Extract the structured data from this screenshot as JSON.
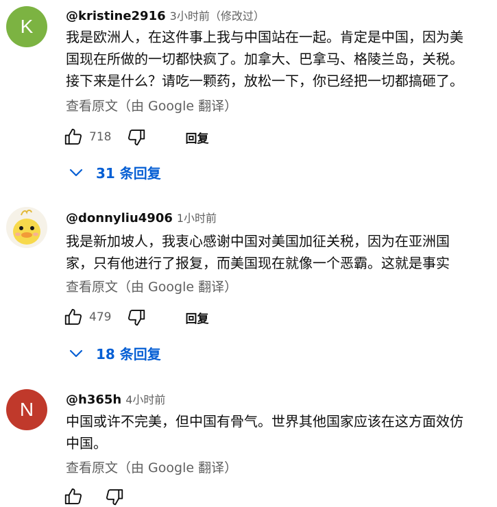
{
  "comments": [
    {
      "avatar_letter": "K",
      "avatar_color": "#7cb342",
      "author": "@kristine2916",
      "time": "3小时前（修改过）",
      "lines": [
        "我是欧洲人，在这件事上我与中国站在一起。肯定是中国，因为美",
        "国现在所做的一切都快疯了。加拿大、巴拿马、格陵兰岛，关税。",
        "接下来是什么？请吃一颗药，放松一下，你已经把一切都搞砸了。"
      ],
      "translate_label": "查看原文（由 Google 翻译）",
      "likes": "718",
      "reply_label": "回复",
      "replies_label": "31 条回复"
    },
    {
      "avatar_letter": "",
      "avatar_color": "#f5d547",
      "author": "@donnyliu4906",
      "time": "1小时前",
      "lines": [
        "我是新加坡人，我衷心感谢中国对美国加征关税，因为在亚洲国",
        "家，只有他进行了报复，而美国现在就像一个恶霸。这就是事实"
      ],
      "translate_label": "查看原文（由 Google 翻译）",
      "likes": "479",
      "reply_label": "回复",
      "replies_label": "18 条回复"
    },
    {
      "avatar_letter": "N",
      "avatar_color": "#c0392b",
      "author": "@h365h",
      "time": "4小时前",
      "lines": [
        "中国或许不完美，但中国有骨气。世界其他国家应该在这方面效仿",
        "中国。"
      ],
      "translate_label": "查看原文（由 Google 翻译）"
    }
  ]
}
